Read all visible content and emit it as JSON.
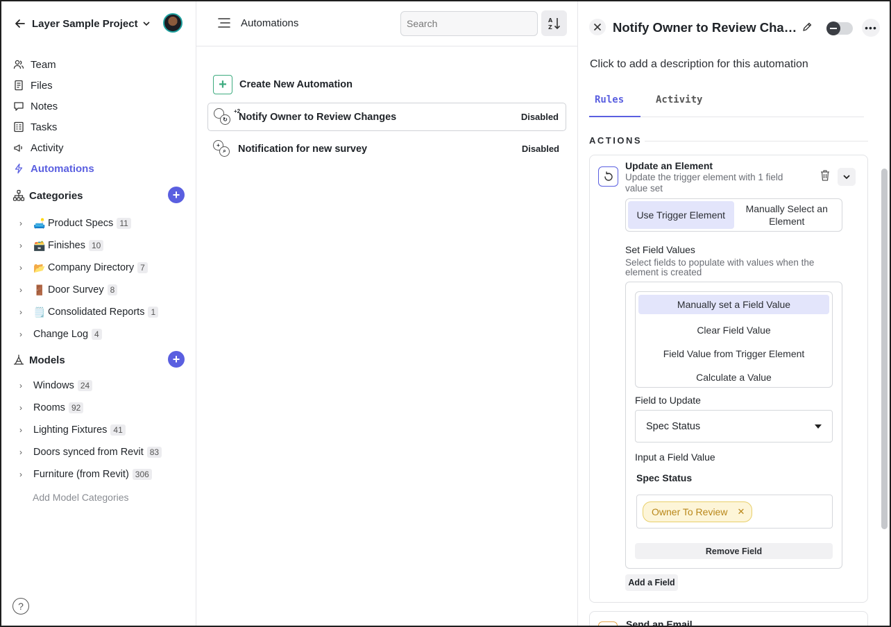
{
  "sidebar": {
    "project": "Layer Sample Project",
    "nav": [
      {
        "label": "Team",
        "icon": "team-icon"
      },
      {
        "label": "Files",
        "icon": "files-icon"
      },
      {
        "label": "Notes",
        "icon": "notes-icon"
      },
      {
        "label": "Tasks",
        "icon": "tasks-icon"
      },
      {
        "label": "Activity",
        "icon": "activity-icon"
      },
      {
        "label": "Automations",
        "icon": "automations-icon"
      }
    ],
    "categories_title": "Categories",
    "categories": [
      {
        "emoji": "🛋️",
        "label": "Product Specs",
        "count": "11"
      },
      {
        "emoji": "🗃️",
        "label": "Finishes",
        "count": "10"
      },
      {
        "emoji": "📂",
        "label": "Company Directory",
        "count": "7"
      },
      {
        "emoji": "🚪",
        "label": "Door Survey",
        "count": "8"
      },
      {
        "emoji": "🗒️",
        "label": "Consolidated Reports",
        "count": "1"
      },
      {
        "emoji": "",
        "label": "Change Log",
        "count": "4"
      }
    ],
    "models_title": "Models",
    "models": [
      {
        "label": "Windows",
        "count": "24"
      },
      {
        "label": "Rooms",
        "count": "92"
      },
      {
        "label": "Lighting Fixtures",
        "count": "41"
      },
      {
        "label": "Doors synced from Revit",
        "count": "83"
      },
      {
        "label": "Furniture (from Revit)",
        "count": "306"
      }
    ],
    "add_model": "Add Model Categories",
    "help": "?"
  },
  "middle": {
    "title": "Automations",
    "search_placeholder": "Search",
    "create_label": "Create New Automation",
    "automations": [
      {
        "name": "Notify Owner to Review Changes",
        "status": "Disabled",
        "extra": "+2"
      },
      {
        "name": "Notification for new survey",
        "status": "Disabled",
        "extra": ""
      }
    ]
  },
  "detail": {
    "title": "Notify Owner to Review Changes",
    "description": "Click to add a description for this automation",
    "tabs": [
      "Rules",
      "Activity"
    ],
    "actions_header": "ACTIONS",
    "action": {
      "title": "Update an Element",
      "subtitle": "Update the trigger element with 1 field value set",
      "segments": [
        "Use Trigger Element",
        "Manually Select an Element"
      ],
      "set_field_values": "Set Field Values",
      "set_field_values_sub": "Select fields to populate with values when the element is created",
      "options": [
        "Manually set a Field Value",
        "Clear Field Value",
        "Field Value from Trigger Element",
        "Calculate a Value"
      ],
      "field_to_update_label": "Field to Update",
      "field_to_update_value": "Spec Status",
      "input_label": "Input a Field Value",
      "input_field_name": "Spec Status",
      "tag": "Owner To Review",
      "remove_field": "Remove Field",
      "add_field": "Add a Field"
    },
    "next_card_peek": "Send an Email"
  },
  "colors": {
    "accent": "#5a5fe0",
    "tag_bg": "#fdf5d8",
    "tag_text": "#b9871a",
    "create_green": "#3dab7f"
  }
}
